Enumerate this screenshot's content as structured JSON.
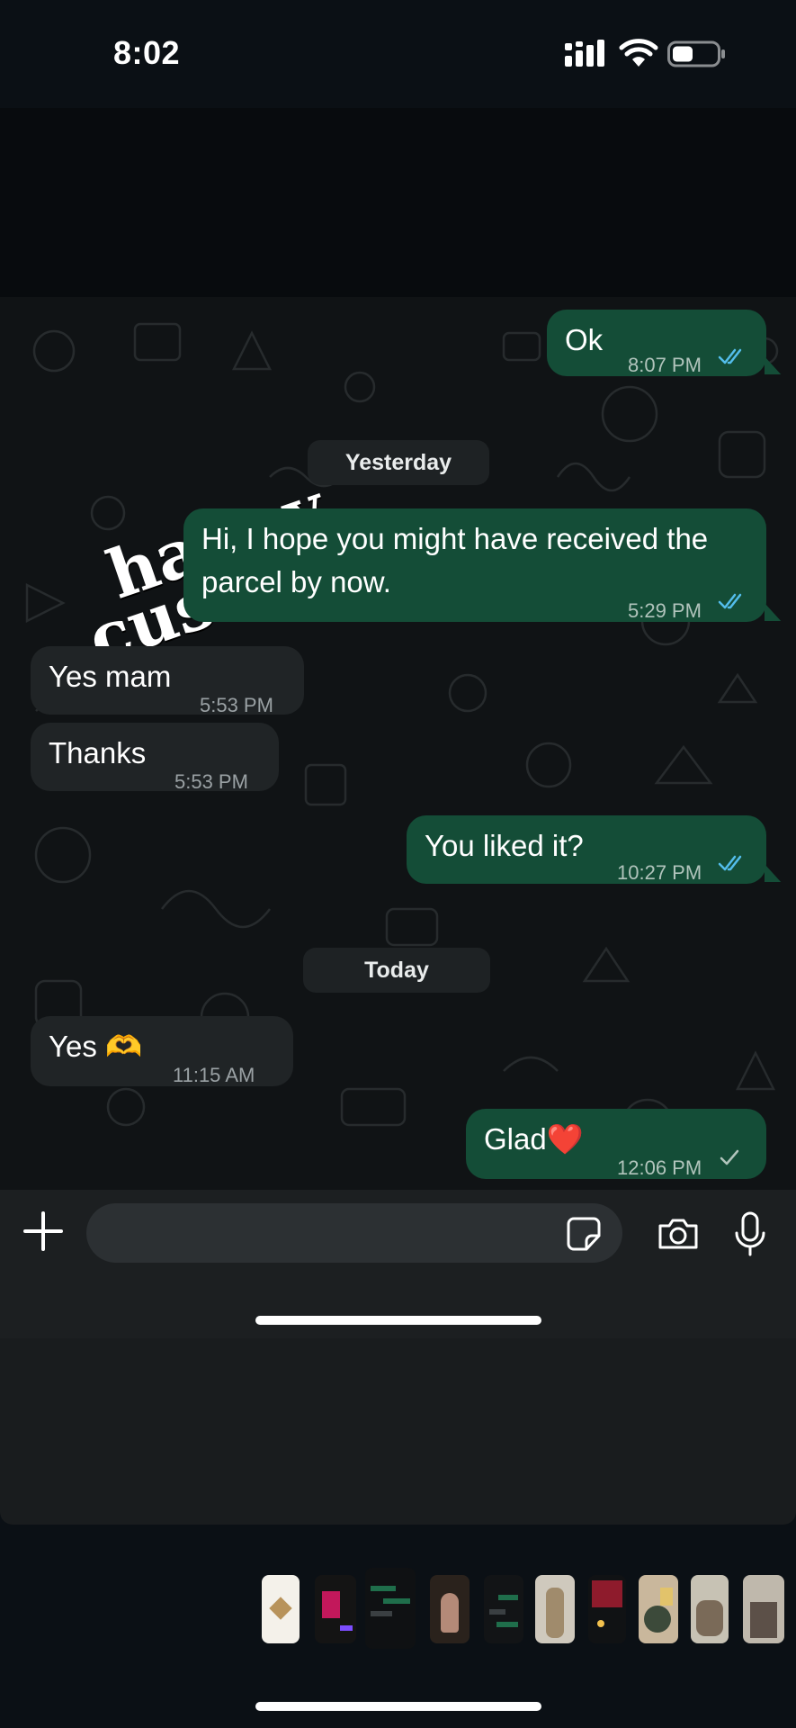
{
  "status_bar": {
    "time": "8:02"
  },
  "sticker": {
    "line1": "happy",
    "line2": "customer"
  },
  "messages": [
    {
      "direction": "out",
      "text": "Ok",
      "time": "8:07 PM",
      "status": "read"
    },
    {
      "direction": "out",
      "text_lines": [
        "Hi, I hope you might have received the",
        "parcel by now."
      ],
      "time": "5:29 PM",
      "status": "read"
    },
    {
      "direction": "in",
      "text": "Yes mam",
      "time": "5:53 PM"
    },
    {
      "direction": "in",
      "text": "Thanks",
      "time": "5:53 PM"
    },
    {
      "direction": "out",
      "text": "You liked it?",
      "time": "10:27 PM",
      "status": "read"
    },
    {
      "direction": "in",
      "text": "Yes 🫶",
      "time": "11:15 AM"
    },
    {
      "direction": "out",
      "text": "Glad❤️",
      "time": "12:06 PM",
      "status": "sent"
    }
  ],
  "date_dividers": [
    "Yesterday",
    "Today"
  ],
  "input_bar": {
    "icons": [
      "plus-icon",
      "sticker-icon",
      "camera-icon",
      "microphone-icon"
    ]
  },
  "colors": {
    "outgoing_bubble": "#144d37",
    "incoming_bubble": "#202426",
    "read_tick": "#53bdeb",
    "background": "#0b1015"
  },
  "thumbnails": [
    "thumbnail-logo",
    "thumbnail-chat-pink",
    "thumbnail-chat-green",
    "thumbnail-dress",
    "thumbnail-chat-dark",
    "thumbnail-outfit-beige",
    "thumbnail-chat-red",
    "thumbnail-photo-people",
    "thumbnail-photo-outfit",
    "thumbnail-photo-store"
  ]
}
